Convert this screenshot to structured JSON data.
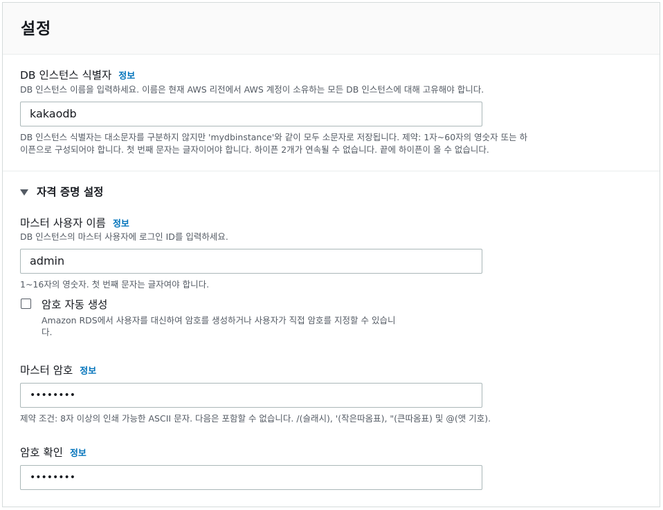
{
  "header": {
    "title": "설정"
  },
  "db_identifier": {
    "label": "DB 인스턴스 식별자",
    "info": "정보",
    "description": "DB 인스턴스 이름을 입력하세요. 이름은 현재 AWS 리전에서 AWS 계정이 소유하는 모든 DB 인스턴스에 대해 고유해야 합니다.",
    "value": "kakaodb",
    "constraint_line1": "DB 인스턴스 식별자는 대소문자를 구분하지 않지만 'mydbinstance'와 같이 모두 소문자로 저장됩니다. 제약: 1자~60자의 영숫자 또는 하",
    "constraint_line2": "이픈으로 구성되어야 합니다. 첫 번째 문자는 글자이어야 합니다. 하이픈 2개가 연속될 수 없습니다. 끝에 하이픈이 올 수 없습니다."
  },
  "credentials": {
    "section_title": "자격 증명 설정",
    "master_username": {
      "label": "마스터 사용자 이름",
      "info": "정보",
      "description": "DB 인스턴스의 마스터 사용자에 로그인 ID를 입력하세요.",
      "value": "admin",
      "constraint": "1~16자의 영숫자. 첫 번째 문자는 글자여야 합니다."
    },
    "auto_generate": {
      "label": "암호 자동 생성",
      "checked": false,
      "description_line1": "Amazon RDS에서 사용자를 대신하여 암호를 생성하거나 사용자가 직접 암호를 지정할 수 있습니",
      "description_line2": "다."
    },
    "master_password": {
      "label": "마스터 암호",
      "info": "정보",
      "value": "••••••••",
      "constraint": "제약 조건: 8자 이상의 인쇄 가능한 ASCII 문자. 다음은 포함할 수 없습니다. /(슬래시), '(작은따옴표), \"(큰따옴표) 및 @(앳 기호)."
    },
    "confirm_password": {
      "label": "암호 확인",
      "info": "정보",
      "value": "••••••••"
    }
  },
  "colors": {
    "link": "#0073bb",
    "border": "#aab7b8",
    "muted_text": "#545b64"
  }
}
